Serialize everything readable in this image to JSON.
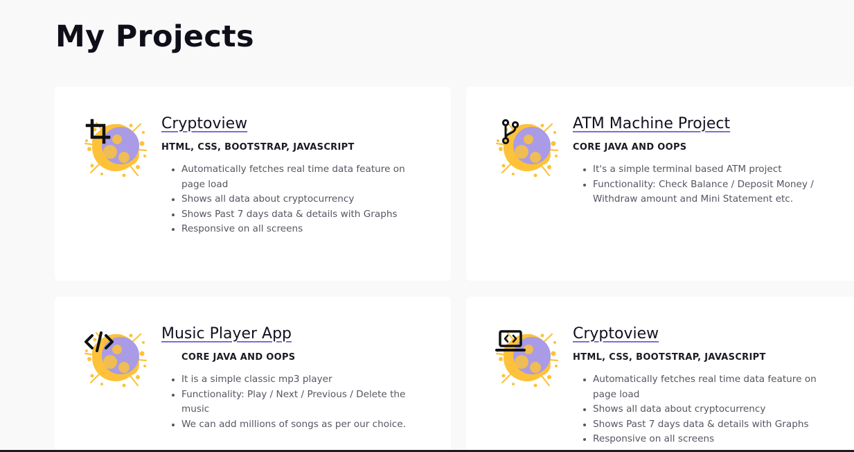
{
  "page": {
    "title": "My Projects"
  },
  "colors": {
    "background": "#f9f9f9",
    "card": "#ffffff",
    "splash_orange": "#fdc23a",
    "splash_purple": "#a99be6",
    "title_underline": "#7b6dd6"
  },
  "projects": [
    {
      "title": "Cryptoview",
      "icon": "crop-icon",
      "tech": "HTML, CSS, BOOTSTRAP, JAVASCRIPT",
      "features": [
        "Automatically fetches real time data feature on page load",
        "Shows all data about cryptocurrency",
        "Shows Past 7 days data & details with Graphs",
        "Responsive on all screens"
      ]
    },
    {
      "title": "ATM Machine Project",
      "icon": "git-branch-icon",
      "tech": "CORE JAVA AND OOPS",
      "features": [
        "It's a simple terminal based ATM project",
        "Functionality: Check Balance / Deposit Money / Withdraw amount and Mini Statement etc."
      ]
    },
    {
      "title": "Music Player App",
      "icon": "code-icon",
      "tech": "CORE JAVA AND OOPS",
      "features": [
        "It is a simple classic mp3 player",
        "Functionality: Play / Next / Previous / Delete the music",
        "We can add millions of songs as per our choice."
      ]
    },
    {
      "title": "Cryptoview",
      "icon": "laptop-code-icon",
      "tech": "HTML, CSS, BOOTSTRAP, JAVASCRIPT",
      "features": [
        "Automatically fetches real time data feature on page load",
        "Shows all data about cryptocurrency",
        "Shows Past 7 days data & details with Graphs",
        "Responsive on all screens"
      ]
    }
  ]
}
